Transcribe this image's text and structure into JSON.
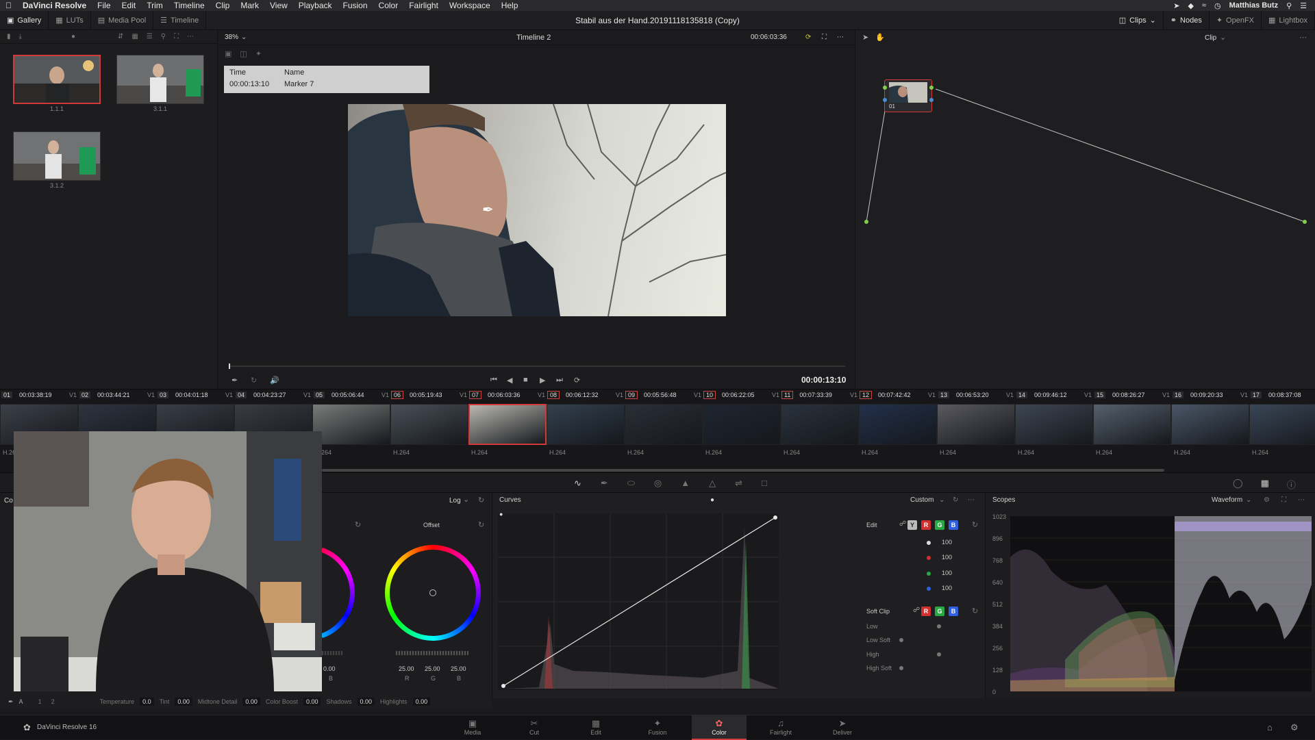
{
  "menubar": {
    "app": "DaVinci Resolve",
    "items": [
      "File",
      "Edit",
      "Trim",
      "Timeline",
      "Clip",
      "Mark",
      "View",
      "Playback",
      "Fusion",
      "Color",
      "Fairlight",
      "Workspace",
      "Help"
    ],
    "user": "Matthias Butz"
  },
  "topbar": {
    "left_tabs": [
      "Gallery",
      "LUTs",
      "Media Pool",
      "Timeline"
    ],
    "project_title": "Stabil aus der Hand.20191118135818 (Copy)",
    "right_tabs": [
      "Clips",
      "Nodes",
      "OpenFX",
      "Lightbox"
    ]
  },
  "gallery": {
    "stills": [
      {
        "label": "1.1.1",
        "selected": true
      },
      {
        "label": "3.1.1",
        "selected": false
      },
      {
        "label": "3.1.2",
        "selected": false
      }
    ]
  },
  "viewer": {
    "zoom": "38%",
    "timeline_name": "Timeline 2",
    "timecode_top": "00:06:03:36",
    "marker": {
      "time_header": "Time",
      "name_header": "Name",
      "time": "00:00:13:10",
      "name": "Marker 7"
    },
    "timecode_bottom": "00:00:13:10"
  },
  "nodes": {
    "mode": "Clip",
    "node_label": "01"
  },
  "clips": [
    {
      "num": "01",
      "tc": "00:03:38:19",
      "track": "V1",
      "codec": "H.264",
      "marked": false,
      "selected": false
    },
    {
      "num": "02",
      "tc": "00:03:44:21",
      "track": "V1",
      "codec": "H.264",
      "marked": false,
      "selected": false
    },
    {
      "num": "03",
      "tc": "00:04:01:18",
      "track": "V1",
      "codec": "H.264",
      "marked": false,
      "selected": false
    },
    {
      "num": "04",
      "tc": "00:04:23:27",
      "track": "V1",
      "codec": "H.264",
      "marked": false,
      "selected": false
    },
    {
      "num": "05",
      "tc": "00:05:06:44",
      "track": "V1",
      "codec": "H.264",
      "marked": false,
      "selected": false
    },
    {
      "num": "06",
      "tc": "00:05:19:43",
      "track": "V1",
      "codec": "H.264",
      "marked": true,
      "selected": false
    },
    {
      "num": "07",
      "tc": "00:06:03:36",
      "track": "V1",
      "codec": "H.264",
      "marked": true,
      "selected": true
    },
    {
      "num": "08",
      "tc": "00:06:12:32",
      "track": "V1",
      "codec": "H.264",
      "marked": true,
      "selected": false
    },
    {
      "num": "09",
      "tc": "00:05:56:48",
      "track": "V1",
      "codec": "H.264",
      "marked": true,
      "selected": false
    },
    {
      "num": "10",
      "tc": "00:06:22:05",
      "track": "V1",
      "codec": "H.264",
      "marked": true,
      "selected": false
    },
    {
      "num": "11",
      "tc": "00:07:33:39",
      "track": "V1",
      "codec": "H.264",
      "marked": true,
      "selected": false
    },
    {
      "num": "12",
      "tc": "00:07:42:42",
      "track": "V1",
      "codec": "H.264",
      "marked": true,
      "selected": false
    },
    {
      "num": "13",
      "tc": "00:06:53:20",
      "track": "V1",
      "codec": "H.264",
      "marked": false,
      "selected": false
    },
    {
      "num": "14",
      "tc": "00:09:46:12",
      "track": "V1",
      "codec": "H.264",
      "marked": false,
      "selected": false
    },
    {
      "num": "15",
      "tc": "00:08:26:27",
      "track": "V1",
      "codec": "H.264",
      "marked": false,
      "selected": false
    },
    {
      "num": "16",
      "tc": "00:09:20:33",
      "track": "V1",
      "codec": "H.264",
      "marked": false,
      "selected": false
    },
    {
      "num": "17",
      "tc": "00:08:37:08",
      "track": "V1",
      "codec": "H.264",
      "marked": false,
      "selected": false
    }
  ],
  "wheels": {
    "panel_label": "Co",
    "mode": "Log",
    "offset_label": "Offset",
    "left_value": "0.00",
    "left_channel": "B",
    "offset_values": [
      "25.00",
      "25.00",
      "25.00"
    ],
    "offset_channels": [
      "R",
      "G",
      "B"
    ]
  },
  "curves": {
    "title": "Curves",
    "preset": "Custom",
    "edit_label": "Edit",
    "channel_buttons": [
      "Y",
      "R",
      "G",
      "B"
    ],
    "intensities": [
      "100",
      "100",
      "100",
      "100"
    ],
    "soft_clip_label": "Soft Clip",
    "soft_clip_rows": [
      "Low",
      "Low Soft",
      "High",
      "High Soft"
    ]
  },
  "scopes": {
    "title": "Scopes",
    "type": "Waveform",
    "scale": [
      "1023",
      "896",
      "768",
      "640",
      "512",
      "384",
      "256",
      "128",
      "0"
    ]
  },
  "bottom_params": [
    {
      "label": "Temperature",
      "value": "0.0"
    },
    {
      "label": "Tint",
      "value": "0.00"
    },
    {
      "label": "Midtone Detail",
      "value": "0.00"
    },
    {
      "label": "Color Boost",
      "value": "0.00"
    },
    {
      "label": "Shadows",
      "value": "0.00"
    },
    {
      "label": "Highlights",
      "value": "0.00"
    }
  ],
  "bottom_pages_numbers": [
    "1",
    "2"
  ],
  "pagebar": {
    "brand": "DaVinci Resolve 16",
    "pages": [
      "Media",
      "Cut",
      "Edit",
      "Fusion",
      "Color",
      "Fairlight",
      "Deliver"
    ],
    "active": "Color"
  },
  "colors": {
    "accent": "#d23a3a",
    "bg": "#1a1a1c",
    "panel": "#1e1e20"
  }
}
